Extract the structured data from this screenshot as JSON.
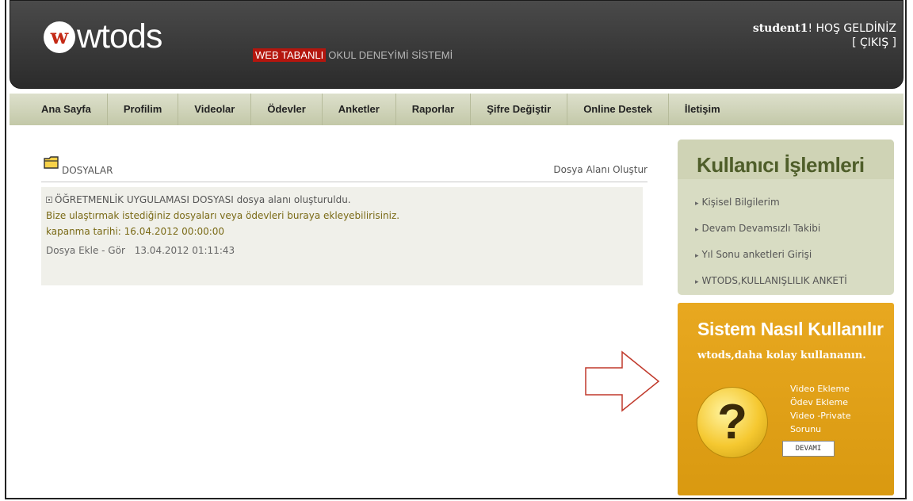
{
  "header": {
    "logo_mark": "w",
    "logo_text": "wtods",
    "tagline_highlight": "WEB TABANLI",
    "tagline_rest": "OKUL DENEYİMİ SİSTEMİ",
    "username": "student1",
    "welcome_suffix": "! HOŞ GELDİNİZ",
    "logout_label": "[ ÇIKIŞ ]"
  },
  "nav": {
    "items": [
      {
        "label": "Ana Sayfa"
      },
      {
        "label": "Profilim"
      },
      {
        "label": "Videolar"
      },
      {
        "label": "Ödevler"
      },
      {
        "label": "Anketler"
      },
      {
        "label": "Raporlar"
      },
      {
        "label": "Şifre Değiştir"
      },
      {
        "label": "Online Destek"
      },
      {
        "label": "İletişim"
      }
    ]
  },
  "files": {
    "title": "DOSYALAR",
    "create_link": "Dosya Alanı Oluştur",
    "entry": {
      "line1": "ÖĞRETMENLİK UYGULAMASI DOSYASI  dosya alanı oluşturuldu.",
      "line2": "Bize ulaştırmak istediğiniz dosyaları veya ödevleri buraya ekleyebilirisiniz.",
      "line3": "kapanma tarihi: 16.04.2012 00:00:00",
      "action_link": "Dosya Ekle - Gör",
      "timestamp": "13.04.2012 01:11:43"
    }
  },
  "user_ops": {
    "title": "Kullanıcı İşlemleri",
    "items": [
      {
        "label": "Kişisel Bilgilerim"
      },
      {
        "label": "Devam Devamsızlı Takibi"
      },
      {
        "label": "Yıl Sonu anketleri Girişi"
      },
      {
        "label": "WTODS,KULLANIŞLILIK ANKETİ"
      }
    ]
  },
  "help": {
    "title": "Sistem Nasıl Kullanılır",
    "subtitle": "wtods,daha kolay kullananın.",
    "links": [
      {
        "label": "Video Ekleme"
      },
      {
        "label": "Ödev Ekleme"
      },
      {
        "label": "Video -Private"
      },
      {
        "label": "Sorunu"
      }
    ],
    "more_button": "DEVAMI",
    "icon_glyph": "?"
  },
  "colors": {
    "header_bg": "#333333",
    "tag_red": "#b4160e",
    "nav_bg": "#cfd3b5",
    "panel_green": "#d8dcc3",
    "panel_title": "#4f5e2a",
    "help_orange": "#e0a018",
    "text_olive": "#7a6a16",
    "arrow_red": "#c0392b"
  },
  "icons": {
    "folder": "folder-icon",
    "arrow": "right-arrow-icon",
    "help": "question-mark-icon"
  }
}
